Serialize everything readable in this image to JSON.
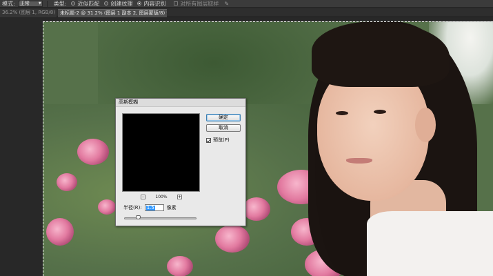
{
  "options_bar": {
    "mode_label": "模式:",
    "mode_value": "正常",
    "type_label": "类型:",
    "type_options": [
      {
        "label": "近似匹配",
        "selected": false
      },
      {
        "label": "创建纹理",
        "selected": false
      },
      {
        "label": "内容识别",
        "selected": true
      }
    ],
    "sample_all_label": "对所有图层取样"
  },
  "tabs": [
    {
      "label": "36.2% (图层 1, RGB/8) *",
      "close": "×"
    },
    {
      "label": "未标题-2 @ 31.2% (图层 1 副本 2, 图层蒙版/8) *",
      "close": "×"
    }
  ],
  "dialog": {
    "title": "高斯模糊",
    "ok_label": "确定",
    "cancel_label": "取消",
    "preview_label": "预览(P)",
    "preview_checked": true,
    "zoom_out": "−",
    "zoom_value": "100%",
    "zoom_in": "+",
    "radius_label": "半径(R):",
    "radius_value": "1.5",
    "radius_unit": "像素",
    "slider_level_fraction": 0.17
  },
  "colors": {
    "app_bg": "#282828",
    "dialog_bg": "#e9e9e9",
    "selection_highlight": "#3399ff"
  },
  "icons": {
    "brush": "brush-pressure-icon"
  }
}
